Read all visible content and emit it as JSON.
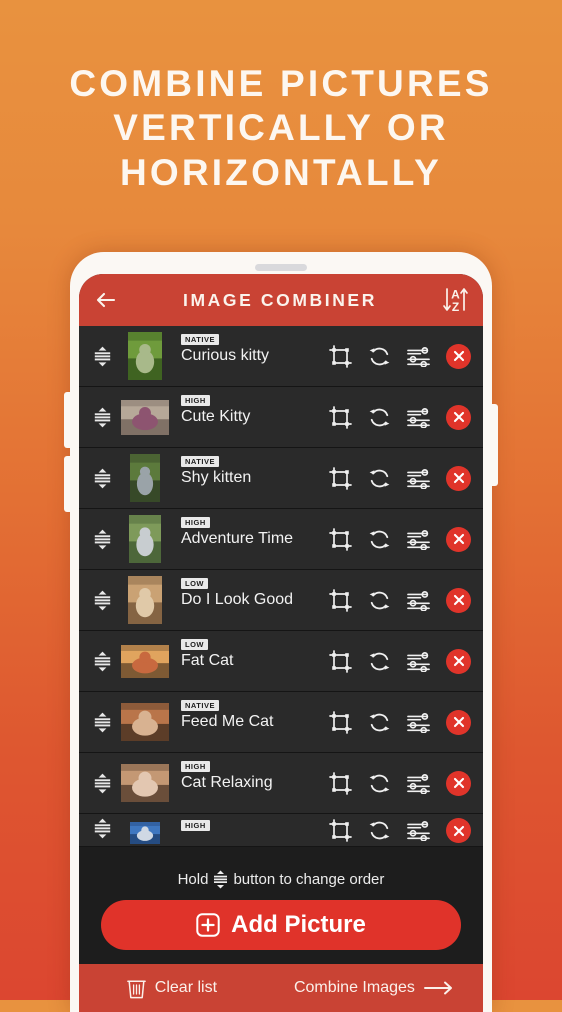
{
  "promo": {
    "line1": "COMBINE PICTURES",
    "line2": "VERTICALLY OR",
    "line3": "HORIZONTALLY"
  },
  "appbar": {
    "back_icon": "arrow-left-icon",
    "title": "IMAGE COMBINER",
    "sort_icon": "sort-alpha-icon",
    "sort_letters": {
      "top": "A",
      "bottom": "Z"
    }
  },
  "list": {
    "rows": [
      {
        "badge": "NATIVE",
        "title": "Curious kitty",
        "thumb_w": 34,
        "thumb_h": 48,
        "c1": "#6f9b3c",
        "c2": "#2f5018",
        "c3": "#a8b98a"
      },
      {
        "badge": "HIGH",
        "title": "Cute Kitty",
        "thumb_w": 48,
        "thumb_h": 35,
        "c1": "#b6a898",
        "c2": "#6d5f55",
        "c3": "#8d5470"
      },
      {
        "badge": "NATIVE",
        "title": "Shy kitten",
        "thumb_w": 30,
        "thumb_h": 48,
        "c1": "#5c7a3c",
        "c2": "#2b3a22",
        "c3": "#9aa3a8"
      },
      {
        "badge": "HIGH",
        "title": "Adventure Time",
        "thumb_w": 32,
        "thumb_h": 48,
        "c1": "#7e9a5a",
        "c2": "#3d5530",
        "c3": "#c8cdd0"
      },
      {
        "badge": "LOW",
        "title": "Do I Look Good",
        "thumb_w": 34,
        "thumb_h": 48,
        "c1": "#caa274",
        "c2": "#6d4f33",
        "c3": "#e0c9a8"
      },
      {
        "badge": "LOW",
        "title": "Fat Cat",
        "thumb_w": 48,
        "thumb_h": 33,
        "c1": "#e0a45e",
        "c2": "#5d4127",
        "c3": "#c8693f"
      },
      {
        "badge": "NATIVE",
        "title": "Feed Me Cat",
        "thumb_w": 48,
        "thumb_h": 38,
        "c1": "#b9754a",
        "c2": "#3d2b1e",
        "c3": "#d8b291"
      },
      {
        "badge": "HIGH",
        "title": "Cat Relaxing",
        "thumb_w": 48,
        "thumb_h": 38,
        "c1": "#c49874",
        "c2": "#4c3627",
        "c3": "#e3c7b1"
      },
      {
        "badge": "HIGH",
        "title": "",
        "thumb_w": 30,
        "thumb_h": 22,
        "c1": "#3f77c0",
        "c2": "#1d3d6e",
        "c3": "#cfd8e4"
      }
    ],
    "row_icons": {
      "handle": "drag-handle-icon",
      "crop": "crop-icon",
      "rotate": "rotate-icon",
      "adjust": "adjust-sliders-icon",
      "delete": "close-x-icon"
    }
  },
  "footer": {
    "hint_before": "Hold",
    "hint_after": "button to change order",
    "hint_icon": "drag-handle-icon",
    "add_label": "Add Picture",
    "add_icon": "plus-square-icon",
    "clear_label": "Clear list",
    "clear_icon": "trash-icon",
    "combine_label": "Combine Images",
    "combine_icon": "arrow-right-icon"
  },
  "colors": {
    "bg_top": "#e8923f",
    "bg_bottom": "#dc4630",
    "appbar_red": "#c94334",
    "accent_red": "#e0332a",
    "row_bg": "#2a2a2a",
    "screen_bg": "#1d1d1d"
  }
}
